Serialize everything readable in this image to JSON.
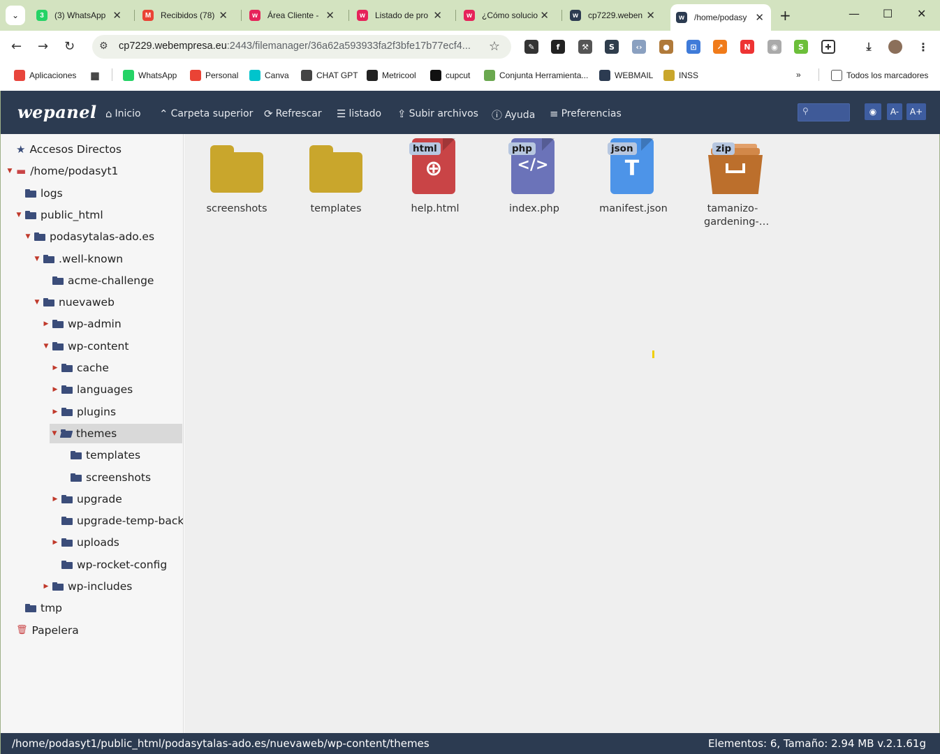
{
  "browser": {
    "tabs": [
      {
        "title": "(3) WhatsApp",
        "icon": "whatsapp-icon",
        "icon_color": "#25d366",
        "icon_text": "3"
      },
      {
        "title": "Recibidos (78)",
        "icon": "gmail-icon",
        "icon_color": "#ea4335",
        "icon_text": "M"
      },
      {
        "title": "Área Cliente - ",
        "icon": "webempresa-icon",
        "icon_color": "#e6235a",
        "icon_text": "w"
      },
      {
        "title": "Listado de pro",
        "icon": "webempresa-icon",
        "icon_color": "#e6235a",
        "icon_text": "w"
      },
      {
        "title": "¿Cómo solucio",
        "icon": "webempresa-icon",
        "icon_color": "#e6235a",
        "icon_text": "w"
      },
      {
        "title": "cp7229.weben",
        "icon": "wepanel-icon",
        "icon_color": "#2c3b51",
        "icon_text": "w"
      },
      {
        "title": "/home/podasy",
        "icon": "wepanel-icon",
        "icon_color": "#2c3b51",
        "icon_text": "w"
      }
    ],
    "url_host": "cp7229.webempresa.eu",
    "url_rest": ":2443/filemanager/36a62a593933fa2f3bfe17b77ecf4...",
    "bookmarks": [
      {
        "label": "Aplicaciones",
        "icon": "apps-grid-icon",
        "color": "#e8453c"
      },
      {
        "label": "WhatsApp",
        "icon": "whatsapp-icon",
        "color": "#25d366"
      },
      {
        "label": "Personal",
        "icon": "gmail-icon",
        "color": "#ea4335"
      },
      {
        "label": "Canva",
        "icon": "canva-icon",
        "color": "#00c4cc"
      },
      {
        "label": "CHAT GPT",
        "icon": "chatgpt-icon",
        "color": "#444444"
      },
      {
        "label": "Metricool",
        "icon": "metricool-icon",
        "color": "#222222"
      },
      {
        "label": "cupcut",
        "icon": "capcut-icon",
        "color": "#111111"
      },
      {
        "label": "Conjunta Herramienta...",
        "icon": "leaf-icon",
        "color": "#6aa84f"
      },
      {
        "label": "WEBMAIL",
        "icon": "wepanel-icon",
        "color": "#2c3b51"
      },
      {
        "label": "INSS",
        "icon": "inss-icon",
        "color": "#c9a62c"
      }
    ],
    "all_bookmarks": "Todos los marcadores"
  },
  "wepanel": {
    "logo": "wepanel",
    "toolbar": [
      {
        "label": "Inicio",
        "icon": "home-icon",
        "glyph": "⌂"
      },
      {
        "label": "Carpeta superior",
        "icon": "chevron-up-icon",
        "glyph": "⌃"
      },
      {
        "label": "Refrescar",
        "icon": "refresh-icon",
        "glyph": "⟳"
      },
      {
        "label": "listado",
        "icon": "list-icon",
        "glyph": "☰"
      },
      {
        "label": "Subir archivos",
        "icon": "upload-icon",
        "glyph": "⇪"
      },
      {
        "label": "Ayuda",
        "icon": "help-icon",
        "glyph": "ⓘ"
      },
      {
        "label": "Preferencias",
        "icon": "sliders-icon",
        "glyph": "≡"
      }
    ],
    "font_smaller": "A-",
    "font_larger": "A+",
    "accent": "#2c3b51",
    "button_color": "#3e5da0"
  },
  "tree": [
    {
      "label": "Accesos Directos",
      "level": 0,
      "arrow": "",
      "icon": "star-icon"
    },
    {
      "label": "/home/podasyt1",
      "level": 0,
      "arrow": "open",
      "icon": "drive-icon"
    },
    {
      "label": "logs",
      "level": 1,
      "arrow": "",
      "icon": "folder-icon"
    },
    {
      "label": "public_html",
      "level": 1,
      "arrow": "open",
      "icon": "folder-icon"
    },
    {
      "label": "podasytalas-ado.es",
      "level": 2,
      "arrow": "open",
      "icon": "folder-icon"
    },
    {
      "label": ".well-known",
      "level": 3,
      "arrow": "open",
      "icon": "folder-icon"
    },
    {
      "label": "acme-challenge",
      "level": 4,
      "arrow": "",
      "icon": "folder-icon"
    },
    {
      "label": "nuevaweb",
      "level": 3,
      "arrow": "open",
      "icon": "folder-icon"
    },
    {
      "label": "wp-admin",
      "level": 4,
      "arrow": "closed",
      "icon": "folder-icon"
    },
    {
      "label": "wp-content",
      "level": 4,
      "arrow": "open",
      "icon": "folder-icon"
    },
    {
      "label": "cache",
      "level": 5,
      "arrow": "closed",
      "icon": "folder-icon"
    },
    {
      "label": "languages",
      "level": 5,
      "arrow": "closed",
      "icon": "folder-icon"
    },
    {
      "label": "plugins",
      "level": 5,
      "arrow": "closed",
      "icon": "folder-icon"
    },
    {
      "label": "themes",
      "level": 5,
      "arrow": "open",
      "icon": "folder-open-icon",
      "selected": true
    },
    {
      "label": "templates",
      "level": 6,
      "arrow": "",
      "icon": "folder-icon"
    },
    {
      "label": "screenshots",
      "level": 6,
      "arrow": "",
      "icon": "folder-icon"
    },
    {
      "label": "upgrade",
      "level": 5,
      "arrow": "closed",
      "icon": "folder-icon"
    },
    {
      "label": "upgrade-temp-backu",
      "level": 5,
      "arrow": "",
      "icon": "folder-icon"
    },
    {
      "label": "uploads",
      "level": 5,
      "arrow": "closed",
      "icon": "folder-icon"
    },
    {
      "label": "wp-rocket-config",
      "level": 5,
      "arrow": "",
      "icon": "folder-icon"
    },
    {
      "label": "wp-includes",
      "level": 4,
      "arrow": "closed",
      "icon": "folder-icon"
    },
    {
      "label": "tmp",
      "level": 1,
      "arrow": "",
      "icon": "folder-icon"
    },
    {
      "label": "Papelera",
      "level": 0,
      "arrow": "",
      "icon": "trash-icon"
    }
  ],
  "files": [
    {
      "name": "screenshots",
      "kind": "folder",
      "icon": "folder-icon",
      "color": "#c9a62c"
    },
    {
      "name": "templates",
      "kind": "folder",
      "icon": "folder-icon",
      "color": "#c9a62c"
    },
    {
      "name": "help.html",
      "kind": "doc",
      "badge": "html",
      "icon": "globe-icon",
      "glyph": "⊕",
      "color": "#c94446"
    },
    {
      "name": "index.php",
      "kind": "doc",
      "badge": "php",
      "icon": "code-icon",
      "glyph": "</>",
      "color": "#6b73b9"
    },
    {
      "name": "manifest.json",
      "kind": "doc",
      "badge": "json",
      "icon": "text-icon",
      "glyph": "T",
      "color": "#4d94e8"
    },
    {
      "name": "tamanizo-gardening-…",
      "kind": "zip",
      "badge": "zip",
      "icon": "archive-icon",
      "color": "#bc6f2c"
    }
  ],
  "status": {
    "path": "/home/podasyt1/public_html/podasytalas-ado.es/nuevaweb/wp-content/themes",
    "info": "Elementos: 6, Tamaño: 2.94 MB v.2.1.61g"
  }
}
